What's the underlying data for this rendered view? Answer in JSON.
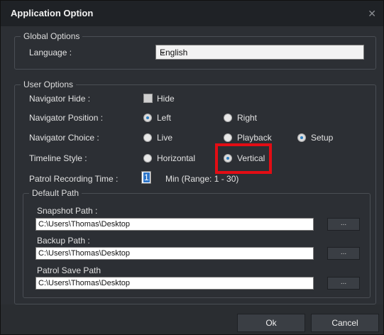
{
  "window": {
    "title": "Application Option",
    "close_glyph": "✕"
  },
  "global_options": {
    "title": "Global Options",
    "language_label": "Language :",
    "language_value": "English"
  },
  "user_options": {
    "title": "User Options",
    "navigator_hide_label": "Navigator Hide :",
    "hide_label": "Hide",
    "hide_checked": false,
    "navigator_position_label": "Navigator Position :",
    "position_left": "Left",
    "position_right": "Right",
    "position_selected": "Left",
    "navigator_choice_label": "Navigator Choice :",
    "choice_live": "Live",
    "choice_playback": "Playback",
    "choice_setup": "Setup",
    "choice_selected": "Setup",
    "timeline_style_label": "Timeline Style :",
    "timeline_horizontal": "Horizontal",
    "timeline_vertical": "Vertical",
    "timeline_selected": "Vertical",
    "patrol_label": "Patrol Recording Time :",
    "patrol_value": "1",
    "patrol_range": "Min (Range: 1 - 30)"
  },
  "default_path": {
    "title": "Default Path",
    "snapshot_label": "Snapshot Path :",
    "snapshot_value": "C:\\Users\\Thomas\\Desktop",
    "backup_label": "Backup Path :",
    "backup_value": "C:\\Users\\Thomas\\Desktop",
    "patrol_save_label": "Patrol Save Path",
    "patrol_save_value": "C:\\Users\\Thomas\\Desktop",
    "browse_label": "..."
  },
  "buttons": {
    "ok": "Ok",
    "cancel": "Cancel"
  },
  "colors": {
    "accent": "#2d7fc1",
    "highlight": "#e30d14"
  }
}
